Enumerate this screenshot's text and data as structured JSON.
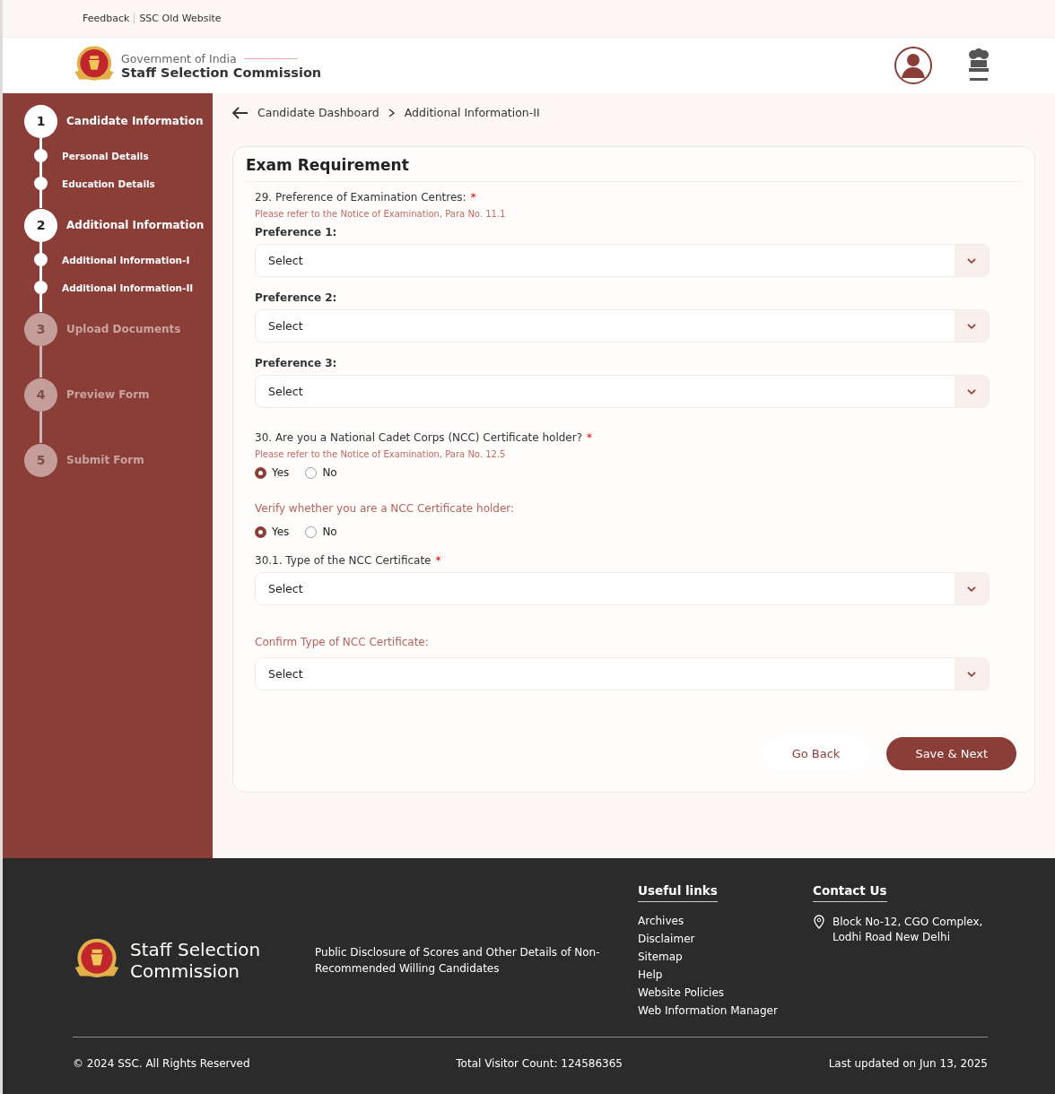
{
  "top_links": [
    "Feedback",
    "SSC Old Website"
  ],
  "header": {
    "org_line": "Government of India",
    "title": "Staff Selection Commission"
  },
  "stepper": [
    {
      "number": "1",
      "label": "Candidate Information",
      "reached": true,
      "children": [
        {
          "label": "Personal Details"
        },
        {
          "label": "Education Details"
        }
      ]
    },
    {
      "number": "2",
      "label": "Additional Information",
      "reached": true,
      "children": [
        {
          "label": "Additional Information-I"
        },
        {
          "label": "Additional Information-II"
        }
      ]
    },
    {
      "number": "3",
      "label": "Upload Documents",
      "reached": false
    },
    {
      "number": "4",
      "label": "Preview Form",
      "reached": false
    },
    {
      "number": "5",
      "label": "Submit Form",
      "reached": false
    }
  ],
  "breadcrumb": [
    "Candidate Dashboard",
    "Additional Information-II"
  ],
  "form": {
    "title": "Exam Requirement",
    "items": [
      {
        "kind": "question",
        "label": "29. Preference of Examination Centres:",
        "required_mark": "*",
        "note": "Please refer to the Notice of Examination, Para No. 11.1"
      },
      {
        "kind": "select",
        "label": "Preference 1:",
        "value": "Select"
      },
      {
        "kind": "select",
        "label": "Preference 2:",
        "value": "Select"
      },
      {
        "kind": "select",
        "label": "Preference 3:",
        "value": "Select"
      },
      {
        "kind": "question",
        "label": "30. Are you a National Cadet Corps (NCC) Certificate holder?",
        "required_mark": "*",
        "note": "Please refer to the Notice of Examination, Para No. 12.5"
      },
      {
        "kind": "radios",
        "options": [
          {
            "label": "Yes",
            "selected": true
          },
          {
            "label": "No",
            "selected": false
          }
        ]
      },
      {
        "kind": "prompt",
        "label": "Verify whether you are a NCC Certificate holder:"
      },
      {
        "kind": "radios",
        "options": [
          {
            "label": "Yes",
            "selected": true
          },
          {
            "label": "No",
            "selected": false
          }
        ]
      },
      {
        "kind": "question",
        "label": "30.1. Type of the NCC Certificate",
        "required_mark": "*"
      },
      {
        "kind": "select",
        "value": "Select"
      },
      {
        "kind": "prompt",
        "label": "Confirm Type of NCC Certificate:"
      },
      {
        "kind": "select",
        "value": "Select"
      }
    ],
    "buttons": [
      {
        "label": "Go Back",
        "kind": "secondary"
      },
      {
        "label": "Save & Next",
        "kind": "primary"
      }
    ]
  },
  "footer": {
    "brand": "Staff Selection Commission",
    "disclosure": "Public Disclosure of Scores and Other Details of Non-Recommended Willing Candidates",
    "useful_links": {
      "title": "Useful links",
      "items": [
        "Archives",
        "Disclaimer",
        "Sitemap",
        "Help",
        "Website Policies",
        "Web Information Manager"
      ]
    },
    "contact": {
      "title": "Contact Us",
      "address": [
        "Block No-12, CGO Complex,",
        "Lodhi Road New Delhi"
      ]
    },
    "copyright": "© 2024 SSC. All Rights Reserved",
    "visitors": "Total Visitor Count: 124586365",
    "updated": "Last updated on Jun 13, 2025"
  }
}
